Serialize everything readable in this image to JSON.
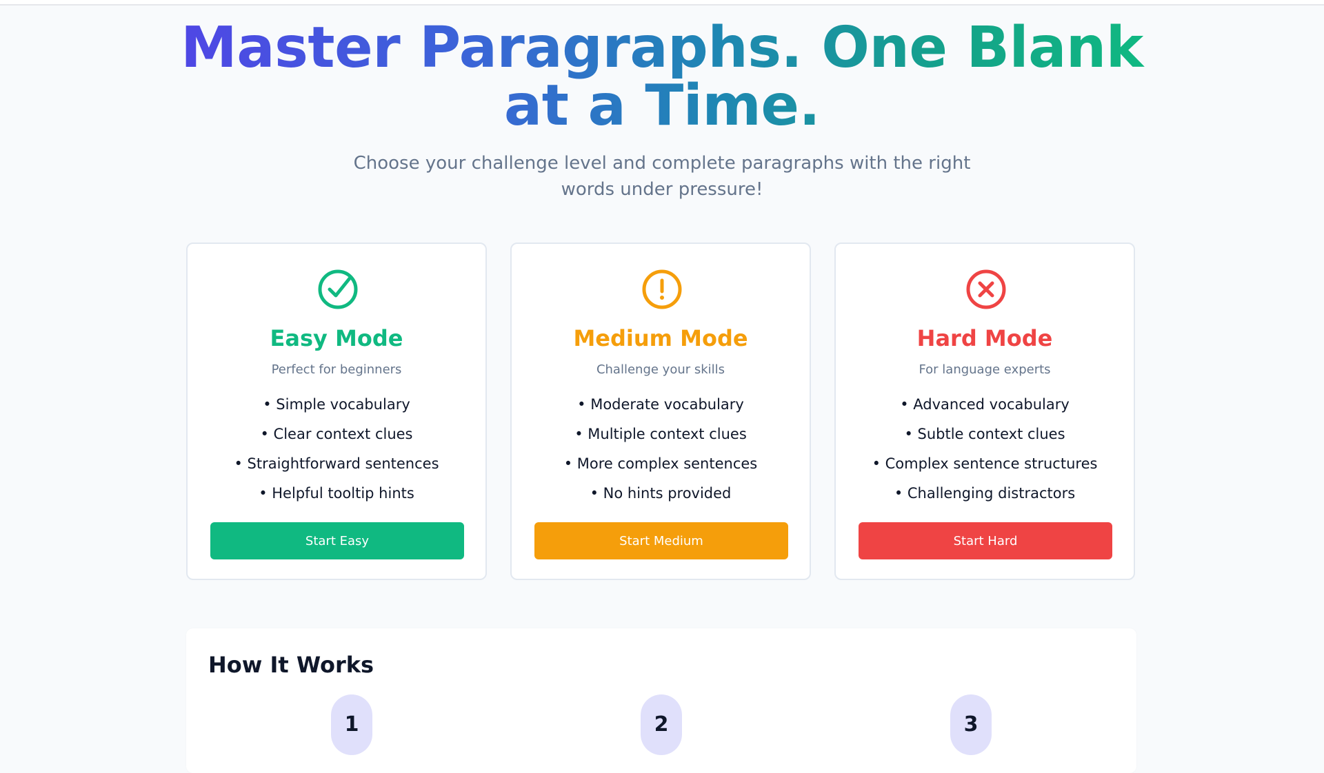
{
  "hero": {
    "title": "Master Paragraphs. One Blank at a Time.",
    "subtitle": "Choose your challenge level and complete paragraphs with the right words under pressure!"
  },
  "modes": [
    {
      "icon": "check-circle-icon",
      "color": "#10b981",
      "title": "Easy Mode",
      "tagline": "Perfect for beginners",
      "features": [
        "Simple vocabulary",
        "Clear context clues",
        "Straightforward sentences",
        "Helpful tooltip hints"
      ],
      "button": "Start Easy"
    },
    {
      "icon": "exclamation-circle-icon",
      "color": "#f59e0b",
      "title": "Medium Mode",
      "tagline": "Challenge your skills",
      "features": [
        "Moderate vocabulary",
        "Multiple context clues",
        "More complex sentences",
        "No hints provided"
      ],
      "button": "Start Medium"
    },
    {
      "icon": "x-circle-icon",
      "color": "#ef4444",
      "title": "Hard Mode",
      "tagline": "For language experts",
      "features": [
        "Advanced vocabulary",
        "Subtle context clues",
        "Complex sentence structures",
        "Challenging distractors"
      ],
      "button": "Start Hard"
    }
  ],
  "how_it_works": {
    "title": "How It Works",
    "steps": [
      "1",
      "2",
      "3"
    ]
  }
}
